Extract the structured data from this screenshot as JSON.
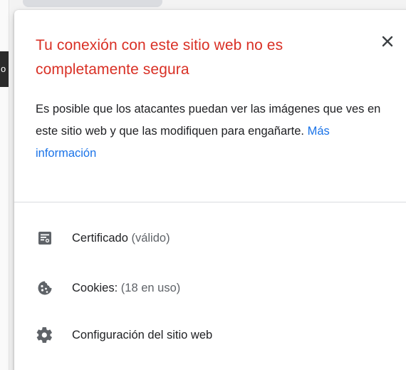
{
  "background": {
    "tab_fragment": "o"
  },
  "popup": {
    "title": "Tu conexión con este sitio web no es completamente segura",
    "description": "Es posible que los atacantes puedan ver las imágenes que ves en este sitio web y que las modifiquen para engañarte.",
    "more_info_link": "Más información",
    "close_icon": "close-icon",
    "accent_color": "#d93025",
    "link_color": "#1a73e8"
  },
  "menu": {
    "items": [
      {
        "icon": "certificate-icon",
        "label": "Certificado",
        "secondary": "(válido)"
      },
      {
        "icon": "cookie-icon",
        "label": "Cookies:",
        "secondary": "(18 en uso)"
      },
      {
        "icon": "gear-icon",
        "label": "Configuración del sitio web",
        "secondary": ""
      }
    ]
  }
}
